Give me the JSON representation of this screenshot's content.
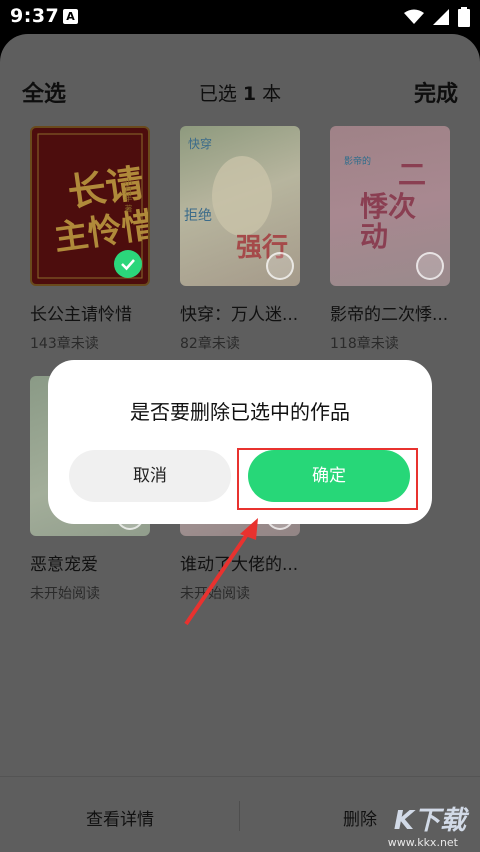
{
  "status_bar": {
    "time": "9:37",
    "notification_letter": "A"
  },
  "header": {
    "select_all": "全选",
    "selected_prefix": "已选 ",
    "selected_count": "1",
    "selected_suffix": " 本",
    "done": "完成"
  },
  "books": [
    {
      "title": "长公主请怜惜",
      "subtitle": "143章未读",
      "cover_text": "长公主请怜惜",
      "cover_author": "小月半 著",
      "selected": true
    },
    {
      "title": "快穿：万人迷...",
      "subtitle": "82章未读",
      "cover_text": "强行",
      "cover_tag": "快穿",
      "cover_tag2": "拒绝",
      "selected": false
    },
    {
      "title": "影帝的二次悸...",
      "subtitle": "118章未读",
      "cover_text": "二次悸动",
      "cover_tag": "影帝的",
      "selected": false
    },
    {
      "title": "恶意宠爱",
      "subtitle": "未开始阅读",
      "selected": false
    },
    {
      "title": "谁动了大佬的...",
      "subtitle": "未开始阅读",
      "selected": false
    }
  ],
  "bottom_bar": {
    "detail": "查看详情",
    "delete": "删除"
  },
  "dialog": {
    "title": "是否要删除已选中的作品",
    "cancel": "取消",
    "confirm": "确定"
  },
  "watermark": {
    "text": "K下载",
    "url": "www.kkx.net"
  },
  "colors": {
    "accent": "#27d778",
    "highlight": "#e8322f",
    "overlay": "#5e5e5e"
  }
}
